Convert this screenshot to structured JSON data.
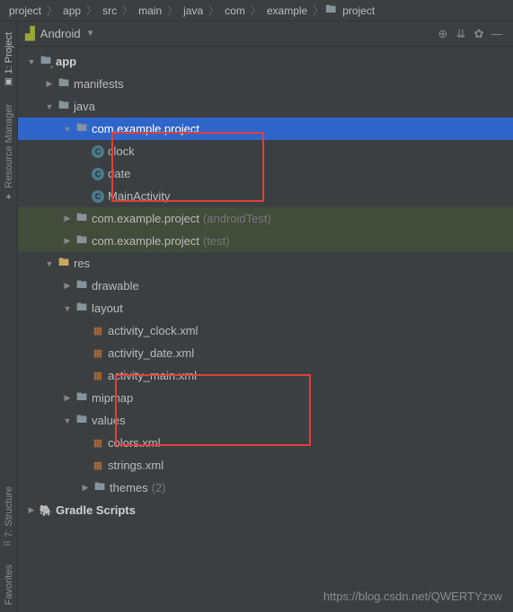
{
  "breadcrumb": [
    "project",
    "app",
    "src",
    "main",
    "java",
    "com",
    "example",
    "project"
  ],
  "panel": {
    "title": "Android"
  },
  "leftTabs": {
    "project": "1: Project",
    "resourceManager": "Resource Manager",
    "structure": "7: Structure",
    "favorites": "Favorites"
  },
  "tree": {
    "app": "app",
    "manifests": "manifests",
    "java": "java",
    "pkg_main": "com.example.project",
    "class_clock": "clock",
    "class_date": "date",
    "class_main": "MainActivity",
    "pkg_androidTest": "com.example.project",
    "pkg_androidTest_suffix": "(androidTest)",
    "pkg_test": "com.example.project",
    "pkg_test_suffix": "(test)",
    "res": "res",
    "drawable": "drawable",
    "layout": "layout",
    "layout_clock": "activity_clock.xml",
    "layout_date": "activity_date.xml",
    "layout_main": "activity_main.xml",
    "mipmap": "mipmap",
    "values": "values",
    "colors": "colors.xml",
    "strings": "strings.xml",
    "themes": "themes",
    "themes_suffix": "(2)",
    "gradle": "Gradle Scripts"
  },
  "watermark": "https://blog.csdn.net/QWERTYzxw"
}
